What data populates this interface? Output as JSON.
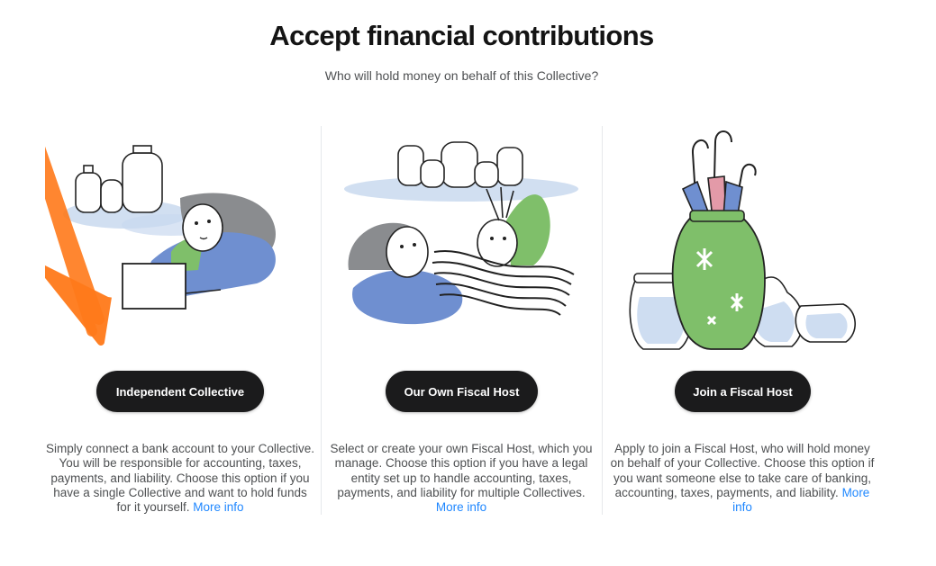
{
  "header": {
    "title": "Accept financial contributions",
    "subtitle": "Who will hold money on behalf of this Collective?"
  },
  "options": [
    {
      "button_label": "Independent Collective",
      "description": "Simply connect a bank account to your Collective. You will be responsible for accounting, taxes, payments, and liability. Choose this option if you have a single Collective and want to hold funds for it yourself.",
      "link_label": "More info"
    },
    {
      "button_label": "Our Own Fiscal Host",
      "description": "Select or create your own Fiscal Host, which you manage. Choose this option if you have a legal entity set up to handle accounting, taxes, payments, and liability for multiple Collectives.",
      "link_label": "More info"
    },
    {
      "button_label": "Join a Fiscal Host",
      "description": "Apply to join a Fiscal Host, who will hold money on behalf of your Collective. Choose this option if you want someone else to take care of banking, accounting, taxes, payments, and liability.",
      "link_label": "More info"
    }
  ],
  "colors": {
    "button_bg": "#1b1b1c",
    "link": "#1f87ff",
    "arrow": "#ff7a1a",
    "green": "#7fbf6a",
    "blue": "#6f8fd0",
    "wash": "#c9d9ef"
  }
}
